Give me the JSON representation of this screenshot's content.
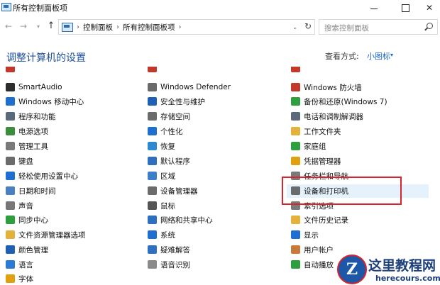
{
  "window": {
    "title": "所有控制面板项"
  },
  "address": {
    "crumbs": [
      "控制面板",
      "所有控制面板项"
    ],
    "dropdown_glyph": "⌄",
    "refresh_glyph": "↻"
  },
  "search": {
    "placeholder": "搜索控制面板"
  },
  "heading": {
    "title": "调整计算机的设置"
  },
  "view_by": {
    "label": "查看方式:",
    "value": "小图标",
    "caret": "▾"
  },
  "columns": [
    [
      {
        "icon": "remote-app-icon",
        "label": "",
        "color": "#c0392b"
      },
      {
        "icon": "smartaudio-icon",
        "label": "SmartAudio",
        "color": "#2d2d2d"
      },
      {
        "icon": "mobility-center-icon",
        "label": "Windows 移动中心",
        "color": "#1f6fd0"
      },
      {
        "icon": "programs-features-icon",
        "label": "程序和功能",
        "color": "#5a6a7a"
      },
      {
        "icon": "power-options-icon",
        "label": "电源选项",
        "color": "#3c8d3c"
      },
      {
        "icon": "admin-tools-icon",
        "label": "管理工具",
        "color": "#7a7a7a"
      },
      {
        "icon": "keyboard-icon",
        "label": "键盘",
        "color": "#6b6b6b"
      },
      {
        "icon": "ease-of-access-icon",
        "label": "轻松使用设置中心",
        "color": "#1f6fd0"
      },
      {
        "icon": "date-time-icon",
        "label": "日期和时间",
        "color": "#4a7fc1"
      },
      {
        "icon": "sound-icon",
        "label": "声音",
        "color": "#777777"
      },
      {
        "icon": "sync-center-icon",
        "label": "同步中心",
        "color": "#2e9e3e"
      },
      {
        "icon": "file-explorer-options-icon",
        "label": "文件资源管理器选项",
        "color": "#e3b23c"
      },
      {
        "icon": "color-management-icon",
        "label": "颜色管理",
        "color": "#1f5fb4"
      },
      {
        "icon": "language-icon",
        "label": "语言",
        "color": "#2b7bd6"
      },
      {
        "icon": "fonts-icon",
        "label": "字体",
        "color": "#e0a010"
      }
    ],
    [
      {
        "icon": "autoplay-icon",
        "label": "",
        "color": "#c0392b"
      },
      {
        "icon": "windows-defender-icon",
        "label": "Windows Defender",
        "color": "#6a6a6a"
      },
      {
        "icon": "security-maintenance-icon",
        "label": "安全性与维护",
        "color": "#1f5fb4"
      },
      {
        "icon": "storage-spaces-icon",
        "label": "存储空间",
        "color": "#6b6b6b"
      },
      {
        "icon": "personalization-icon",
        "label": "个性化",
        "color": "#1f6fd0"
      },
      {
        "icon": "recovery-icon",
        "label": "恢复",
        "color": "#2e8ad0"
      },
      {
        "icon": "default-programs-icon",
        "label": "默认程序",
        "color": "#2e6fc0"
      },
      {
        "icon": "region-icon",
        "label": "区域",
        "color": "#3a7fc8"
      },
      {
        "icon": "device-manager-icon",
        "label": "设备管理器",
        "color": "#6b6b6b"
      },
      {
        "icon": "mouse-icon",
        "label": "鼠标",
        "color": "#555555"
      },
      {
        "icon": "network-sharing-icon",
        "label": "网络和共享中心",
        "color": "#2e6fc0"
      },
      {
        "icon": "system-icon",
        "label": "系统",
        "color": "#1f6fd0"
      },
      {
        "icon": "troubleshooting-icon",
        "label": "疑难解答",
        "color": "#2e6fc0"
      },
      {
        "icon": "speech-recognition-icon",
        "label": "语音识别",
        "color": "#8a8a8a"
      }
    ],
    [
      {
        "icon": "indexing-icon",
        "label": "",
        "color": "#c0392b"
      },
      {
        "icon": "firewall-icon",
        "label": "Windows 防火墙",
        "color": "#c0392b"
      },
      {
        "icon": "backup-restore-icon",
        "label": "备份和还原(Windows 7)",
        "color": "#2e9e3e"
      },
      {
        "icon": "phone-modem-icon",
        "label": "电话和调制解调器",
        "color": "#5a6a7a"
      },
      {
        "icon": "work-folders-icon",
        "label": "工作文件夹",
        "color": "#e3b23c"
      },
      {
        "icon": "homegroup-icon",
        "label": "家庭组",
        "color": "#2e9e3e"
      },
      {
        "icon": "credential-manager-icon",
        "label": "凭据管理器",
        "color": "#e0a010"
      },
      {
        "icon": "taskbar-navigation-icon",
        "label": "任务栏和导航",
        "color": "#7a7a7a"
      },
      {
        "icon": "devices-printers-icon",
        "label": "设备和打印机",
        "color": "#6b6b6b"
      },
      {
        "icon": "indexing-options-icon",
        "label": "索引选项",
        "color": "#7a7a7a"
      },
      {
        "icon": "file-history-icon",
        "label": "文件历史记录",
        "color": "#e3b23c"
      },
      {
        "icon": "display-icon",
        "label": "显示",
        "color": "#1f6fd0"
      },
      {
        "icon": "user-accounts-icon",
        "label": "用户帐户",
        "color": "#c87a3a"
      },
      {
        "icon": "autoplay-2-icon",
        "label": "自动播放",
        "color": "#2e9e3e"
      }
    ]
  ],
  "watermark": {
    "badge": "Z",
    "title": "这里教程网",
    "url": "herecours.com"
  }
}
